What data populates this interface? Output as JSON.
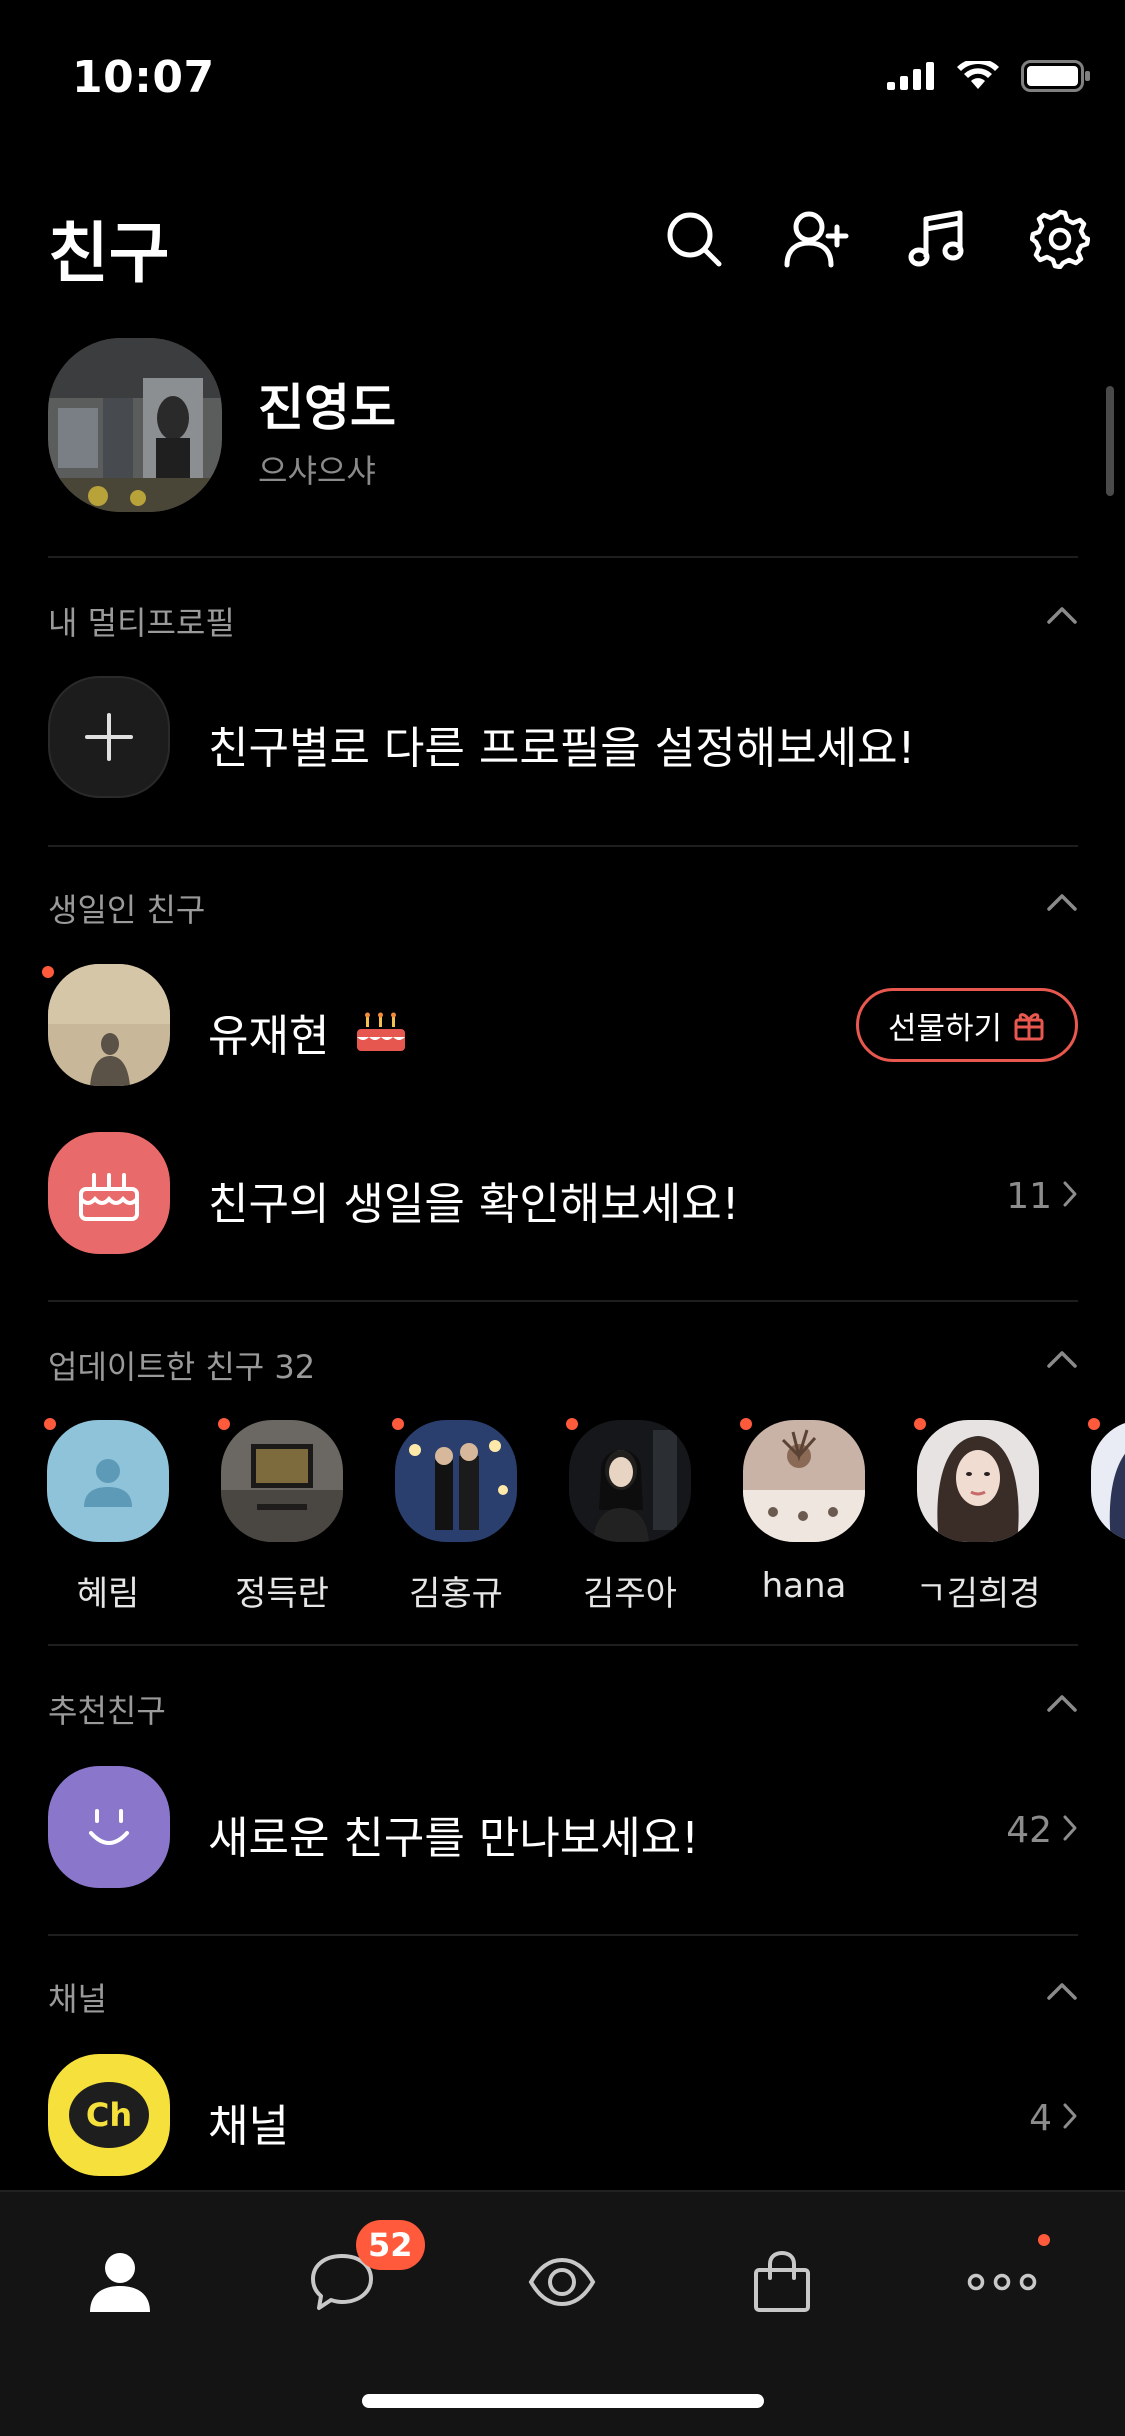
{
  "status_bar": {
    "time": "10:07"
  },
  "header": {
    "title": "친구"
  },
  "my_profile": {
    "name": "진영도",
    "status_message": "으샤으샤"
  },
  "multi_profile": {
    "section_label": "내 멀티프로필",
    "prompt": "친구별로 다른 프로필을 설정해보세요!"
  },
  "birthday": {
    "section_label": "생일인 친구",
    "friend_name": "유재현",
    "gift_label": "선물하기",
    "check_prompt": "친구의 생일을 확인해보세요!",
    "check_count": "11"
  },
  "updated_friends": {
    "section_label": "업데이트한 친구 32",
    "items": [
      {
        "name": "혜림",
        "icon": "default-avatar-icon"
      },
      {
        "name": "정득란"
      },
      {
        "name": "김홍규"
      },
      {
        "name": "김주아"
      },
      {
        "name": "hana"
      },
      {
        "name": "ㄱ김희경"
      }
    ]
  },
  "recommended": {
    "section_label": "추천친구",
    "prompt": "새로운 친구를 만나보세요!",
    "count": "42"
  },
  "channel": {
    "section_label": "채널",
    "label": "채널",
    "count": "4",
    "icon_text": "Ch"
  },
  "tab_bar": {
    "chat_badge": "52",
    "tabs": [
      "friends-tab",
      "chats-tab",
      "view-tab",
      "shopping-tab",
      "more-tab"
    ]
  },
  "colors": {
    "accent": "#ff5a3c",
    "gift_border": "#e8584f",
    "birthday_bg": "#e96a6a",
    "recommend_bg": "#8a77cc",
    "channel_bg": "#f5e03c"
  }
}
